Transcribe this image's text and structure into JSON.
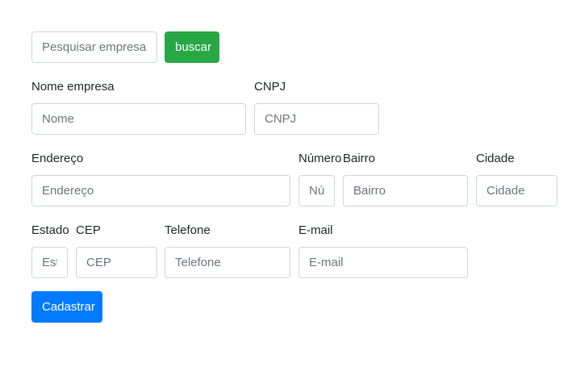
{
  "search": {
    "placeholder": "Pesquisar empresa ...",
    "button_label": "buscar"
  },
  "form": {
    "nome_empresa": {
      "label": "Nome empresa",
      "placeholder": "Nome"
    },
    "cnpj": {
      "label": "CNPJ",
      "placeholder": "CNPJ"
    },
    "endereco": {
      "label": "Endereço",
      "placeholder": "Endereço"
    },
    "numero": {
      "label": "Número",
      "placeholder": "Número"
    },
    "bairro": {
      "label": "Bairro",
      "placeholder": "Bairro"
    },
    "cidade": {
      "label": "Cidade",
      "placeholder": "Cidade"
    },
    "estado": {
      "label": "Estado",
      "placeholder": "Estado"
    },
    "cep": {
      "label": "CEP",
      "placeholder": "CEP"
    },
    "telefone": {
      "label": "Telefone",
      "placeholder": "Telefone"
    },
    "email": {
      "label": "E-mail",
      "placeholder": "E-mail"
    },
    "submit_label": "Cadastrar"
  },
  "colors": {
    "success": "#28a745",
    "primary": "#007bff",
    "border": "#ced4da",
    "placeholder": "#6c757d"
  }
}
